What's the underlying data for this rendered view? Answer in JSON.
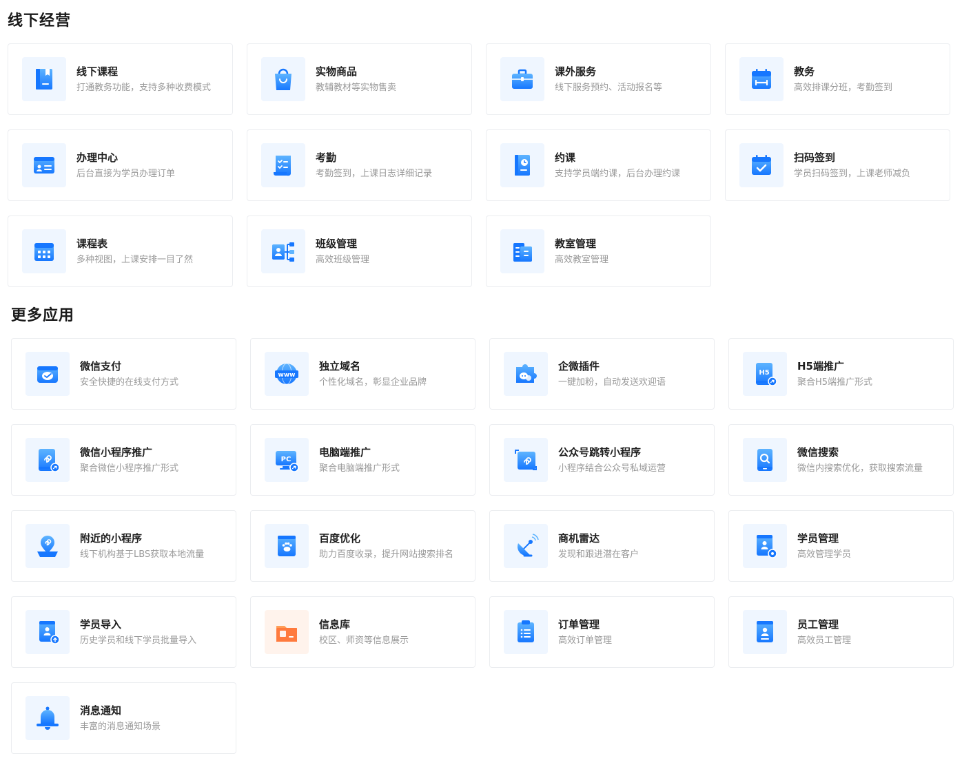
{
  "sections": [
    {
      "title": "线下经营",
      "items": [
        {
          "title": "线下课程",
          "desc": "打通教务功能，支持多种收费模式",
          "icon": "book-icon"
        },
        {
          "title": "实物商品",
          "desc": "教辅教材等实物售卖",
          "icon": "shopping-bag-icon"
        },
        {
          "title": "课外服务",
          "desc": "线下服务预约、活动报名等",
          "icon": "briefcase-icon"
        },
        {
          "title": "教务",
          "desc": "高效排课分班，考勤签到",
          "icon": "calendar-ruler-icon"
        },
        {
          "title": "办理中心",
          "desc": "后台直接为学员办理订单",
          "icon": "id-card-icon"
        },
        {
          "title": "考勤",
          "desc": "考勤签到，上课日志详细记录",
          "icon": "checklist-scroll-icon"
        },
        {
          "title": "约课",
          "desc": "支持学员端约课，后台办理约课",
          "icon": "clock-book-icon"
        },
        {
          "title": "扫码签到",
          "desc": "学员扫码签到，上课老师减负",
          "icon": "calendar-check-icon"
        },
        {
          "title": "课程表",
          "desc": "多种视图，上课安排一目了然",
          "icon": "calendar-grid-icon"
        },
        {
          "title": "班级管理",
          "desc": "高效班级管理",
          "icon": "class-tree-icon"
        },
        {
          "title": "教室管理",
          "desc": "高效教室管理",
          "icon": "building-icon"
        }
      ]
    },
    {
      "title": "更多应用",
      "items": [
        {
          "title": "微信支付",
          "desc": "安全快捷的在线支付方式",
          "icon": "wechat-pay-icon"
        },
        {
          "title": "独立域名",
          "desc": "个性化域名，彰显企业品牌",
          "icon": "www-icon"
        },
        {
          "title": "企微插件",
          "desc": "一键加粉，自动发送欢迎语",
          "icon": "puzzle-chat-icon"
        },
        {
          "title": "H5端推广",
          "desc": "聚合H5端推广形式",
          "icon": "h5-promo-icon",
          "glyph": "H5"
        },
        {
          "title": "微信小程序推广",
          "desc": "聚合微信小程序推广形式",
          "icon": "mini-program-promo-icon"
        },
        {
          "title": "电脑端推广",
          "desc": "聚合电脑端推广形式",
          "icon": "pc-promo-icon",
          "glyph": "PC"
        },
        {
          "title": "公众号跳转小程序",
          "desc": "小程序结合公众号私域运营",
          "icon": "mini-program-jump-icon"
        },
        {
          "title": "微信搜索",
          "desc": "微信内搜索优化，获取搜索流量",
          "icon": "phone-search-icon"
        },
        {
          "title": "附近的小程序",
          "desc": "线下机构基于LBS获取本地流量",
          "icon": "location-pin-icon"
        },
        {
          "title": "百度优化",
          "desc": "助力百度收录，提升网站搜索排名",
          "icon": "baidu-paw-icon"
        },
        {
          "title": "商机雷达",
          "desc": "发现和跟进潜在客户",
          "icon": "radar-dish-icon"
        },
        {
          "title": "学员管理",
          "desc": "高效管理学员",
          "icon": "student-gear-icon"
        },
        {
          "title": "学员导入",
          "desc": "历史学员和线下学员批量导入",
          "icon": "student-import-icon"
        },
        {
          "title": "信息库",
          "desc": "校区、师资等信息展示",
          "icon": "info-folder-icon",
          "accent": "orange"
        },
        {
          "title": "订单管理",
          "desc": "高效订单管理",
          "icon": "order-list-icon"
        },
        {
          "title": "员工管理",
          "desc": "高效员工管理",
          "icon": "staff-badge-icon"
        },
        {
          "title": "消息通知",
          "desc": "丰富的消息通知场景",
          "icon": "bell-icon"
        }
      ]
    }
  ],
  "colors": {
    "primary": "#1677ff",
    "light": "#5eb4ff",
    "icon_bg": "#eff6ff",
    "orange": "#ff7a3d"
  }
}
